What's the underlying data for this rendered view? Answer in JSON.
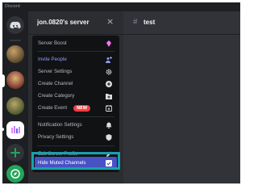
{
  "window": {
    "title": "Discord"
  },
  "server": {
    "name": "jon.0820's server",
    "close_glyph": "×"
  },
  "channel": {
    "hash_glyph": "#",
    "name": "test"
  },
  "menu": {
    "items": [
      {
        "label": "Server Boost",
        "icon": "boost-icon"
      },
      {
        "label": "Invite People",
        "icon": "add-user-icon"
      },
      {
        "label": "Server Settings",
        "icon": "gear-icon"
      },
      {
        "label": "Create Channel",
        "icon": "plus-circle-icon"
      },
      {
        "label": "Create Category",
        "icon": "folder-plus-icon"
      },
      {
        "label": "Create Event",
        "icon": "calendar-plus-icon",
        "badge": "NEW"
      },
      {
        "label": "Notification Settings",
        "icon": "bell-icon"
      },
      {
        "label": "Privacy Settings",
        "icon": "shield-icon"
      },
      {
        "label": "Edit Server Profile",
        "icon": "pencil-icon"
      },
      {
        "label": "Hide Muted Channels",
        "icon": "checkbox-checked-icon",
        "checked": true
      }
    ]
  },
  "colors": {
    "accent": "#4752c4",
    "invite": "#949cf7",
    "boost": "#ff73fa",
    "highlight_border": "#17a2ad",
    "new_badge": "#f23f43",
    "green": "#23a55a"
  }
}
